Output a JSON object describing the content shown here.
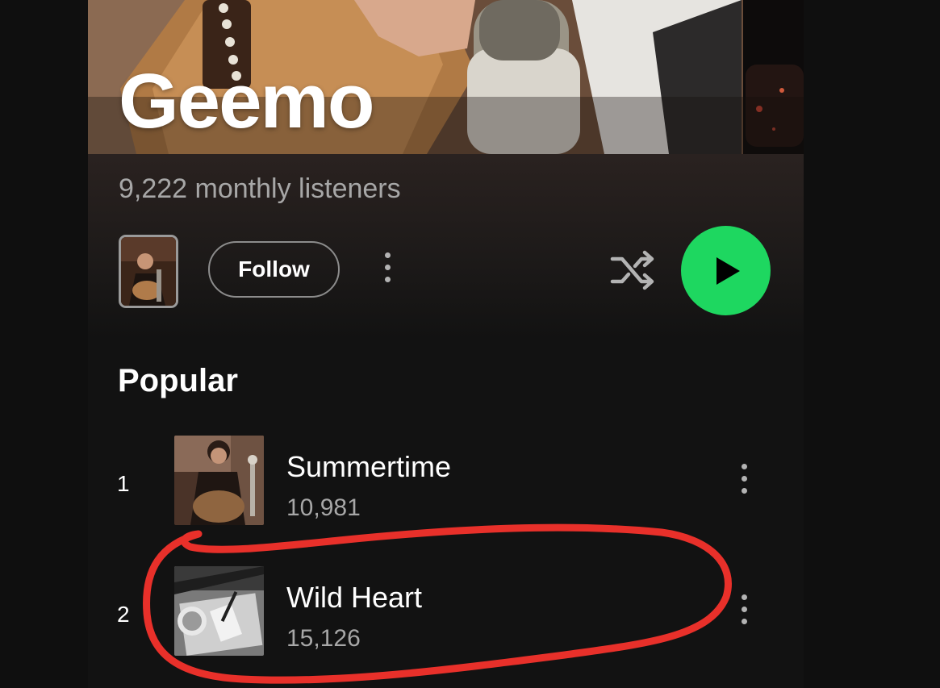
{
  "artist": {
    "name": "Geemo",
    "monthly_listeners": "9,222 monthly listeners"
  },
  "actions": {
    "follow_label": "Follow",
    "shuffle_icon": "shuffle-icon",
    "play_icon": "play-icon",
    "more_icon": "more-vertical-icon",
    "play_color": "#1ed760"
  },
  "popular": {
    "title": "Popular",
    "tracks": [
      {
        "rank": "1",
        "title": "Summertime",
        "plays": "10,981"
      },
      {
        "rank": "2",
        "title": "Wild Heart",
        "plays": "15,126"
      }
    ]
  },
  "annotation": {
    "color": "#e8302a",
    "highlighted_track": "2"
  }
}
